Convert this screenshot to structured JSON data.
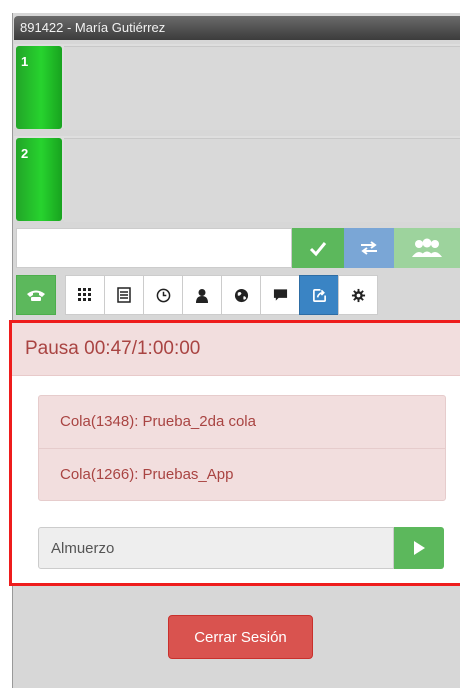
{
  "header": {
    "title": "891422 - María Gutiérrez"
  },
  "lines": [
    {
      "number": "1"
    },
    {
      "number": "2"
    }
  ],
  "dial": {
    "value": ""
  },
  "actions": {
    "accept_icon": "check-icon",
    "transfer_icon": "transfer-icon",
    "conference_icon": "users-icon"
  },
  "toolbar": {
    "items": [
      "phone-icon",
      "dialpad-icon",
      "list-icon",
      "clock-icon",
      "contact-icon",
      "globe-icon",
      "chat-icon",
      "pause-icon",
      "settings-icon"
    ],
    "active": "pause-icon"
  },
  "pause": {
    "title": "Pausa 00:47/1:00:00",
    "queues": [
      "Cola(1348): Prueba_2da cola",
      "Cola(1266): Pruebas_App"
    ],
    "reason": "Almuerzo"
  },
  "logout_label": "Cerrar Sesión",
  "colors": {
    "success": "#5cb85c",
    "primary": "#3a84c4",
    "danger": "#d9534f",
    "alert_text": "#a94442",
    "alert_bg": "#f2dede",
    "highlight_border": "#ee1c1c"
  }
}
